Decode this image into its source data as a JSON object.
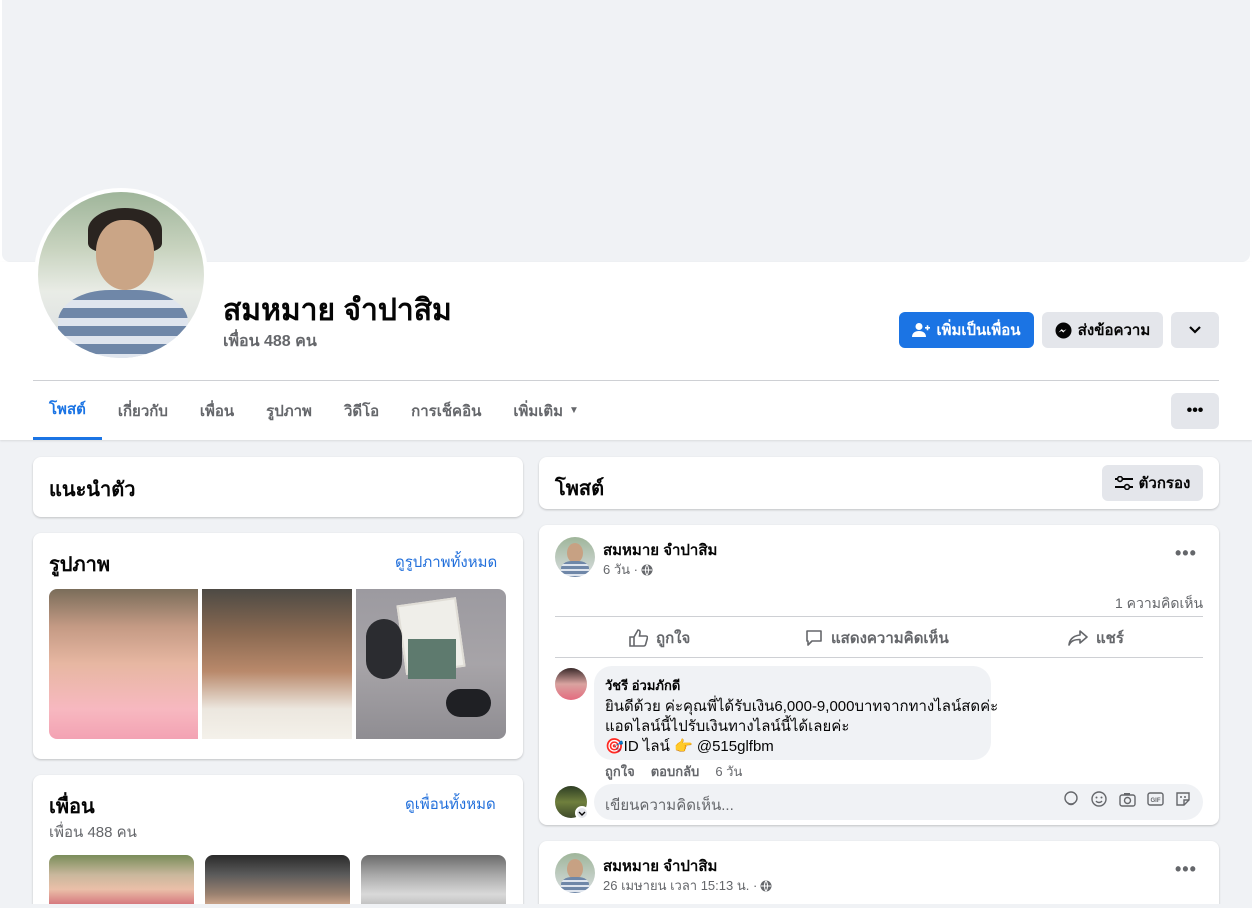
{
  "profile": {
    "name": "สมหมาย จำปาสิม",
    "friends_count": "เพื่อน 488 คน",
    "add_friend_label": "เพิ่มเป็นเพื่อน",
    "message_label": "ส่งข้อความ"
  },
  "tabs": [
    {
      "label": "โพสต์",
      "active": true
    },
    {
      "label": "เกี่ยวกับ"
    },
    {
      "label": "เพื่อน"
    },
    {
      "label": "รูปภาพ"
    },
    {
      "label": "วิดีโอ"
    },
    {
      "label": "การเช็คอิน"
    },
    {
      "label": "เพิ่มเติม"
    }
  ],
  "intro": {
    "title": "แนะนำตัว"
  },
  "photos": {
    "title": "รูปภาพ",
    "see_all": "ดูรูปภาพทั้งหมด"
  },
  "friends": {
    "title": "เพื่อน",
    "see_all": "ดูเพื่อนทั้งหมด",
    "count": "เพื่อน 488 คน"
  },
  "posts_header": {
    "title": "โพสต์",
    "filter_label": "ตัวกรอง"
  },
  "post1": {
    "author": "สมหมาย จำปาสิม",
    "time": "6 วัน ·",
    "comment_count": "1 ความคิดเห็น",
    "actions": {
      "like": "ถูกใจ",
      "comment": "แสดงความคิดเห็น",
      "share": "แชร์"
    },
    "comment": {
      "author": "วัชรี อ่วมภักดี",
      "lines": [
        "ยินดีด้วย ค่ะคุณพี่ได้รับเงิน6,000-9,000บาทจากทางไลน์สดค่ะ",
        "แอดไลน์นี้ไปรับเงินทางไลน์นี้ได้เลยค่ะ",
        "🎯ID ไลน์ 👉 @515glfbm"
      ],
      "like": "ถูกใจ",
      "reply": "ตอบกลับ",
      "time": "6 วัน"
    },
    "compose_placeholder": "เขียนความคิดเห็น..."
  },
  "post2": {
    "author": "สมหมาย จำปาสิม",
    "time": "26 เมษายน เวลา 15:13 น. ·"
  },
  "colors": {
    "accent": "#1b74e4",
    "link": "#216fdb",
    "page_bg": "#f0f2f5"
  }
}
